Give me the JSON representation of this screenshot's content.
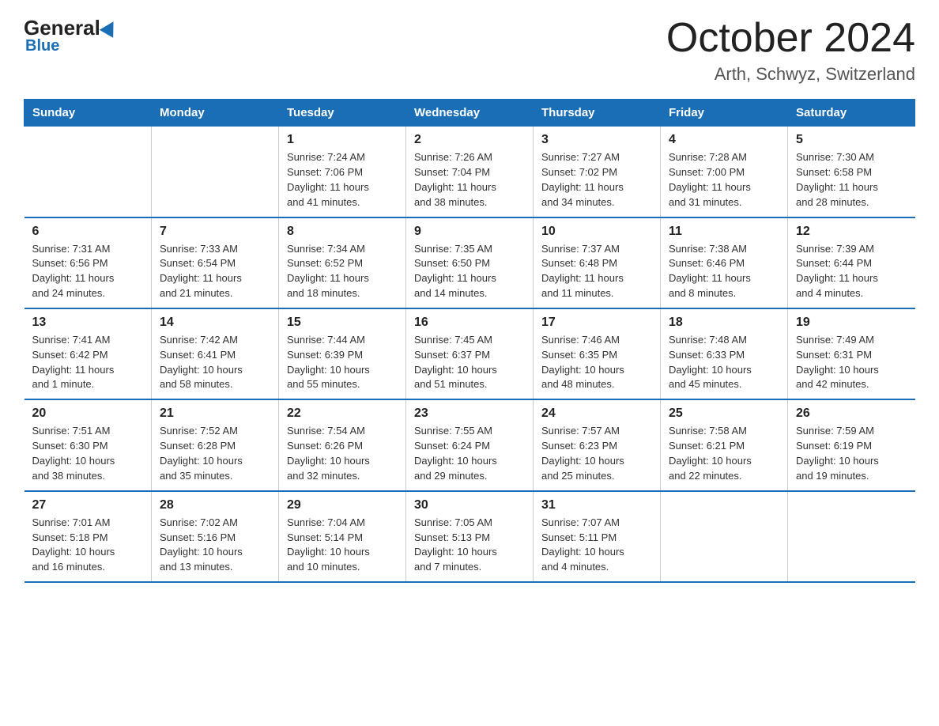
{
  "header": {
    "logo_general": "General",
    "logo_blue": "Blue",
    "month_title": "October 2024",
    "location": "Arth, Schwyz, Switzerland"
  },
  "days_of_week": [
    "Sunday",
    "Monday",
    "Tuesday",
    "Wednesday",
    "Thursday",
    "Friday",
    "Saturday"
  ],
  "weeks": [
    [
      {
        "day": "",
        "info": ""
      },
      {
        "day": "",
        "info": ""
      },
      {
        "day": "1",
        "info": "Sunrise: 7:24 AM\nSunset: 7:06 PM\nDaylight: 11 hours\nand 41 minutes."
      },
      {
        "day": "2",
        "info": "Sunrise: 7:26 AM\nSunset: 7:04 PM\nDaylight: 11 hours\nand 38 minutes."
      },
      {
        "day": "3",
        "info": "Sunrise: 7:27 AM\nSunset: 7:02 PM\nDaylight: 11 hours\nand 34 minutes."
      },
      {
        "day": "4",
        "info": "Sunrise: 7:28 AM\nSunset: 7:00 PM\nDaylight: 11 hours\nand 31 minutes."
      },
      {
        "day": "5",
        "info": "Sunrise: 7:30 AM\nSunset: 6:58 PM\nDaylight: 11 hours\nand 28 minutes."
      }
    ],
    [
      {
        "day": "6",
        "info": "Sunrise: 7:31 AM\nSunset: 6:56 PM\nDaylight: 11 hours\nand 24 minutes."
      },
      {
        "day": "7",
        "info": "Sunrise: 7:33 AM\nSunset: 6:54 PM\nDaylight: 11 hours\nand 21 minutes."
      },
      {
        "day": "8",
        "info": "Sunrise: 7:34 AM\nSunset: 6:52 PM\nDaylight: 11 hours\nand 18 minutes."
      },
      {
        "day": "9",
        "info": "Sunrise: 7:35 AM\nSunset: 6:50 PM\nDaylight: 11 hours\nand 14 minutes."
      },
      {
        "day": "10",
        "info": "Sunrise: 7:37 AM\nSunset: 6:48 PM\nDaylight: 11 hours\nand 11 minutes."
      },
      {
        "day": "11",
        "info": "Sunrise: 7:38 AM\nSunset: 6:46 PM\nDaylight: 11 hours\nand 8 minutes."
      },
      {
        "day": "12",
        "info": "Sunrise: 7:39 AM\nSunset: 6:44 PM\nDaylight: 11 hours\nand 4 minutes."
      }
    ],
    [
      {
        "day": "13",
        "info": "Sunrise: 7:41 AM\nSunset: 6:42 PM\nDaylight: 11 hours\nand 1 minute."
      },
      {
        "day": "14",
        "info": "Sunrise: 7:42 AM\nSunset: 6:41 PM\nDaylight: 10 hours\nand 58 minutes."
      },
      {
        "day": "15",
        "info": "Sunrise: 7:44 AM\nSunset: 6:39 PM\nDaylight: 10 hours\nand 55 minutes."
      },
      {
        "day": "16",
        "info": "Sunrise: 7:45 AM\nSunset: 6:37 PM\nDaylight: 10 hours\nand 51 minutes."
      },
      {
        "day": "17",
        "info": "Sunrise: 7:46 AM\nSunset: 6:35 PM\nDaylight: 10 hours\nand 48 minutes."
      },
      {
        "day": "18",
        "info": "Sunrise: 7:48 AM\nSunset: 6:33 PM\nDaylight: 10 hours\nand 45 minutes."
      },
      {
        "day": "19",
        "info": "Sunrise: 7:49 AM\nSunset: 6:31 PM\nDaylight: 10 hours\nand 42 minutes."
      }
    ],
    [
      {
        "day": "20",
        "info": "Sunrise: 7:51 AM\nSunset: 6:30 PM\nDaylight: 10 hours\nand 38 minutes."
      },
      {
        "day": "21",
        "info": "Sunrise: 7:52 AM\nSunset: 6:28 PM\nDaylight: 10 hours\nand 35 minutes."
      },
      {
        "day": "22",
        "info": "Sunrise: 7:54 AM\nSunset: 6:26 PM\nDaylight: 10 hours\nand 32 minutes."
      },
      {
        "day": "23",
        "info": "Sunrise: 7:55 AM\nSunset: 6:24 PM\nDaylight: 10 hours\nand 29 minutes."
      },
      {
        "day": "24",
        "info": "Sunrise: 7:57 AM\nSunset: 6:23 PM\nDaylight: 10 hours\nand 25 minutes."
      },
      {
        "day": "25",
        "info": "Sunrise: 7:58 AM\nSunset: 6:21 PM\nDaylight: 10 hours\nand 22 minutes."
      },
      {
        "day": "26",
        "info": "Sunrise: 7:59 AM\nSunset: 6:19 PM\nDaylight: 10 hours\nand 19 minutes."
      }
    ],
    [
      {
        "day": "27",
        "info": "Sunrise: 7:01 AM\nSunset: 5:18 PM\nDaylight: 10 hours\nand 16 minutes."
      },
      {
        "day": "28",
        "info": "Sunrise: 7:02 AM\nSunset: 5:16 PM\nDaylight: 10 hours\nand 13 minutes."
      },
      {
        "day": "29",
        "info": "Sunrise: 7:04 AM\nSunset: 5:14 PM\nDaylight: 10 hours\nand 10 minutes."
      },
      {
        "day": "30",
        "info": "Sunrise: 7:05 AM\nSunset: 5:13 PM\nDaylight: 10 hours\nand 7 minutes."
      },
      {
        "day": "31",
        "info": "Sunrise: 7:07 AM\nSunset: 5:11 PM\nDaylight: 10 hours\nand 4 minutes."
      },
      {
        "day": "",
        "info": ""
      },
      {
        "day": "",
        "info": ""
      }
    ]
  ]
}
